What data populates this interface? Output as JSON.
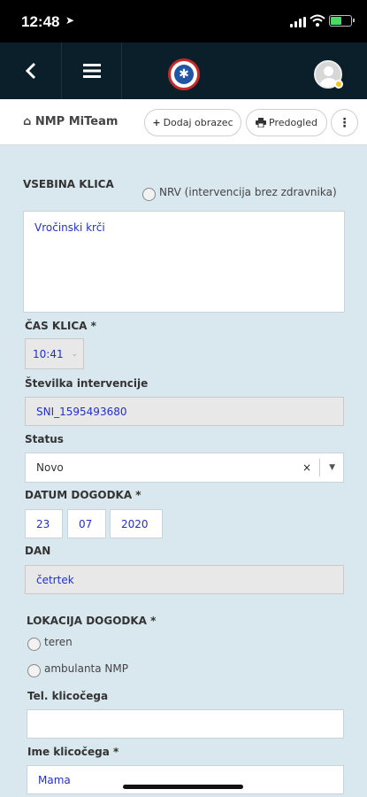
{
  "status_bar": {
    "time": "12:48",
    "location_icon": "location-arrow-icon"
  },
  "nav": {
    "back_icon": "chevron-left-icon",
    "menu_icon": "hamburger-menu-icon",
    "logo_icon": "ems-star-of-life-icon",
    "avatar_icon": "user-avatar-icon"
  },
  "toolbar": {
    "home_label": "NMP MiTeam",
    "add_form_label": "Dodaj obrazec",
    "preview_label": "Predogled"
  },
  "form": {
    "call_content_label": "VSEBINA KLICA",
    "nrv_label": "NRV (intervencija brez zdravnika)",
    "call_content_value": "Vročinski krči",
    "call_time_label": "ČAS KLICA *",
    "call_time_value": "10:41",
    "intervention_number_label": "Številka intervencije",
    "intervention_number_value": "SNI_1595493680",
    "status_label": "Status",
    "status_value": "Novo",
    "event_date_label": "DATUM DOGODKA *",
    "event_date_day": "23",
    "event_date_month": "07",
    "event_date_year": "2020",
    "day_label": "DAN",
    "day_value": "četrtek",
    "location_label": "LOKACIJA DOGODKA *",
    "location_options": [
      "teren",
      "ambulanta NMP"
    ],
    "caller_phone_label": "Tel. klicočega",
    "caller_phone_value": "",
    "caller_name_label": "Ime klicočega *",
    "caller_name_value": "Mama"
  },
  "colors": {
    "navbar": "#0b1f2a",
    "form_bg": "#d9e7ee",
    "value_text": "#2230c9",
    "logo_ring": "#c52a2a"
  }
}
